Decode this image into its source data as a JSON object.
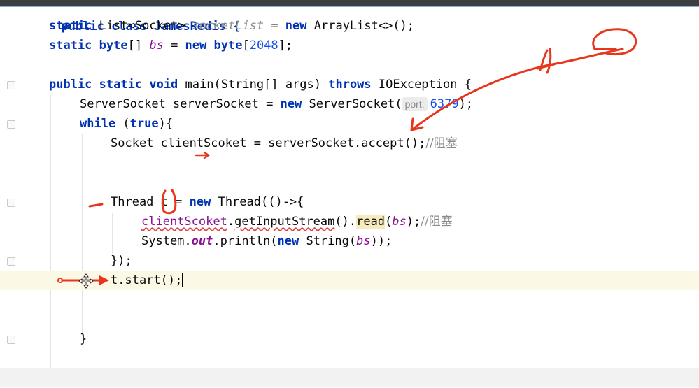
{
  "editor": {
    "lines": {
      "l0": [
        "public class JamesRedis {"
      ],
      "l1": [
        "static",
        " List<Socket> ",
        "socketList",
        " = ",
        "new",
        " ArrayList<>();"
      ],
      "l2": [
        "static",
        " ",
        "byte",
        "[] ",
        "bs",
        " = ",
        "new",
        " ",
        "byte",
        "[",
        "2048",
        "];"
      ],
      "l4": [
        "public",
        " ",
        "static",
        " ",
        "void",
        " main(String[] args) ",
        "throws",
        " IOException {"
      ],
      "l5": [
        "ServerSocket serverSocket = ",
        "new",
        " ServerSocket(",
        "port:",
        " ",
        "6379",
        ");"
      ],
      "l6": [
        "while",
        " (",
        "true",
        "){"
      ],
      "l7": [
        "Socket clientScoket = serverSocket.accept();",
        "//阻塞"
      ],
      "l10": [
        "Thread ",
        "t",
        " = ",
        "new",
        " Thread(()->{"
      ],
      "l11": [
        "clientScoket",
        ".",
        "getInputStream",
        "().",
        "read",
        "(",
        "bs",
        ");",
        "//阻塞"
      ],
      "l12": [
        "System.",
        "out",
        ".println(",
        "new",
        " String(",
        "bs",
        "));"
      ],
      "l13": [
        "});"
      ],
      "l14": [
        "t.start();"
      ],
      "l17": [
        "}"
      ]
    }
  },
  "colors": {
    "keyword": "#0033b3",
    "field": "#871094",
    "number": "#1750eb",
    "comment": "#8c8c8c",
    "annotation": "#e8361c",
    "current_line": "#fcf8e6"
  },
  "icons": {
    "fold": "fold-marker-icon",
    "cursor": "move-cursor-icon"
  }
}
